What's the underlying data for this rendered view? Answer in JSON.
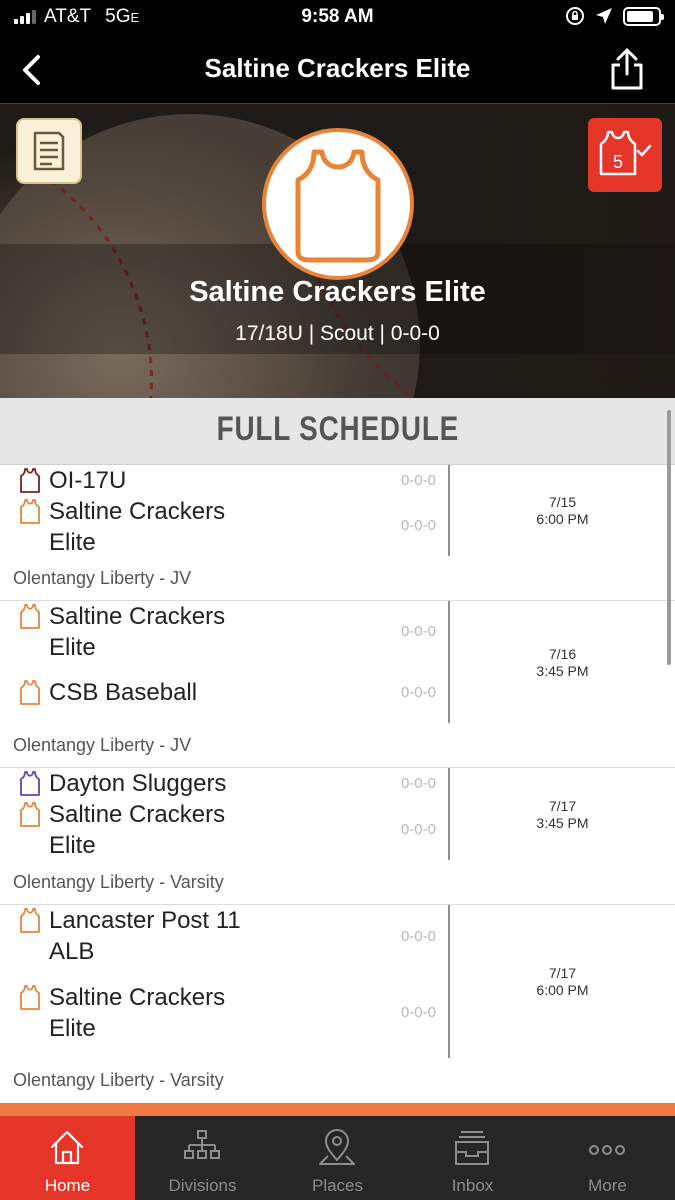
{
  "status_bar": {
    "carrier": "AT&T",
    "network": "5G",
    "network_suffix": "E",
    "time": "9:58 AM",
    "battery_level": 0.85
  },
  "nav": {
    "title": "Saltine Crackers Elite",
    "back_icon": "chevron-left-icon",
    "share_icon": "share-icon"
  },
  "hero": {
    "team_name": "Saltine Crackers Elite",
    "meta": "17/18U | Scout | 0-0-0",
    "roster_count": "5",
    "logo_color": "#e8843a"
  },
  "schedule": {
    "header": "FULL SCHEDULE",
    "games": [
      {
        "teams": [
          {
            "name": "OI-17U",
            "record": "0-0-0",
            "jersey_color": "#7a1f1f"
          },
          {
            "name": "Saltine Crackers Elite",
            "record": "0-0-0",
            "jersey_color": "#e8843a"
          }
        ],
        "date": "7/15",
        "time": "6:00 PM",
        "venue": "Olentangy Liberty - JV"
      },
      {
        "teams": [
          {
            "name": "Saltine Crackers Elite",
            "record": "0-0-0",
            "jersey_color": "#e8843a"
          },
          {
            "name": "CSB Baseball",
            "record": "0-0-0",
            "jersey_color": "#e8843a"
          }
        ],
        "date": "7/16",
        "time": "3:45 PM",
        "venue": "Olentangy Liberty - JV"
      },
      {
        "teams": [
          {
            "name": "Dayton Sluggers",
            "record": "0-0-0",
            "jersey_color": "#6a3fb5"
          },
          {
            "name": "Saltine Crackers Elite",
            "record": "0-0-0",
            "jersey_color": "#e8843a"
          }
        ],
        "date": "7/17",
        "time": "3:45 PM",
        "venue": "Olentangy Liberty - Varsity"
      },
      {
        "teams": [
          {
            "name": "Lancaster Post 11 ALB",
            "record": "0-0-0",
            "jersey_color": "#e8843a"
          },
          {
            "name": "Saltine Crackers Elite",
            "record": "0-0-0",
            "jersey_color": "#e8843a"
          }
        ],
        "date": "7/17",
        "time": "6:00 PM",
        "venue": "Olentangy Liberty - Varsity"
      }
    ]
  },
  "tab_bar": {
    "tabs": [
      {
        "label": "Home",
        "icon": "home-icon",
        "active": true
      },
      {
        "label": "Divisions",
        "icon": "bracket-icon",
        "active": false
      },
      {
        "label": "Places",
        "icon": "map-pin-icon",
        "active": false
      },
      {
        "label": "Inbox",
        "icon": "inbox-icon",
        "active": false
      },
      {
        "label": "More",
        "icon": "more-icon",
        "active": false
      }
    ]
  },
  "colors": {
    "accent": "#e53528",
    "orange": "#ef7b42",
    "tab_bar": "#262626"
  }
}
